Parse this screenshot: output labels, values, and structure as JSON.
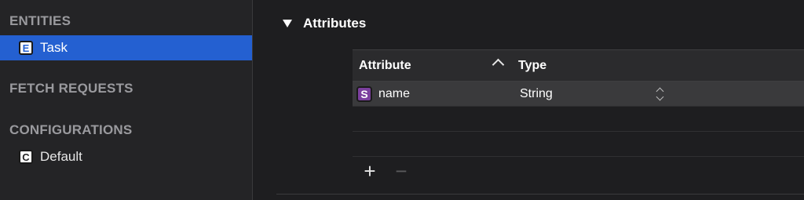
{
  "sidebar": {
    "entities_header": "ENTITIES",
    "entities": [
      {
        "badge": "E",
        "label": "Task",
        "selected": true
      }
    ],
    "fetch_requests_header": "FETCH REQUESTS",
    "configurations_header": "CONFIGURATIONS",
    "configurations": [
      {
        "badge": "C",
        "label": "Default"
      }
    ]
  },
  "main": {
    "attributes_title": "Attributes",
    "table": {
      "columns": [
        "Attribute",
        "Type"
      ],
      "rows": [
        {
          "badge": "S",
          "name": "name",
          "type": "String"
        }
      ]
    },
    "add_label": "+",
    "remove_label": "−"
  },
  "colors": {
    "selection": "#2460d1",
    "string_badge": "#7b3f9e"
  }
}
